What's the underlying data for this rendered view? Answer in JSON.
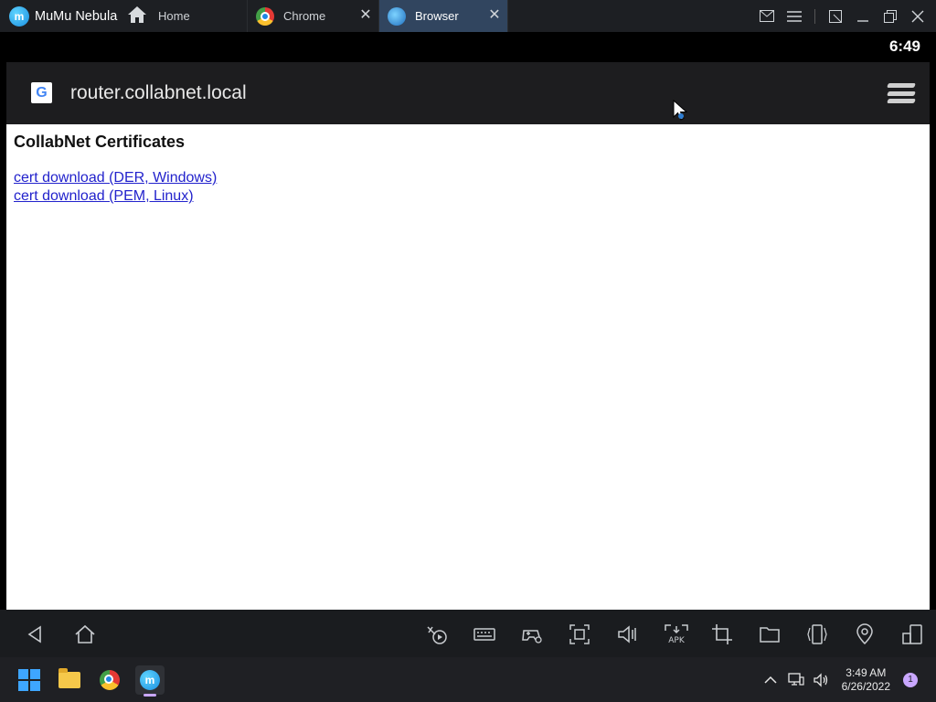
{
  "emulator": {
    "app_name": "MuMu Nebula",
    "tabs": [
      {
        "label": "Home"
      },
      {
        "label": "Chrome"
      },
      {
        "label": "Browser"
      }
    ]
  },
  "android": {
    "status_time": "6:49"
  },
  "browser": {
    "url": "router.collabnet.local"
  },
  "page": {
    "title": "CollabNet Certificates",
    "links": [
      {
        "label": "cert download (DER, Windows)"
      },
      {
        "label": "cert download (PEM, Linux)"
      }
    ]
  },
  "taskbar": {
    "time": "3:49 AM",
    "date": "6/26/2022",
    "notification_count": "1"
  },
  "colors": {
    "link": "#2222cc",
    "active_tab": "#31455f"
  }
}
